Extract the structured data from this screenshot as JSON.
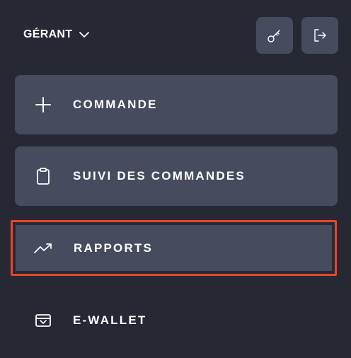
{
  "header": {
    "role_label": "GÉRANT",
    "role_chevron_icon": "chevron-down-icon",
    "key_button_icon": "key-icon",
    "logout_button_icon": "logout-icon"
  },
  "menu": {
    "items": [
      {
        "label": "COMMANDE",
        "icon": "plus-icon"
      },
      {
        "label": "SUIVI DES COMMANDES",
        "icon": "clipboard-icon"
      },
      {
        "label": "RAPPORTS",
        "icon": "trending-up-icon",
        "highlighted": true
      },
      {
        "label": "E-WALLET",
        "icon": "wallet-icon"
      }
    ]
  },
  "colors": {
    "background": "#262934",
    "item_background": "#474b5e",
    "highlight_border": "#e8452a",
    "text": "#ffffff"
  }
}
